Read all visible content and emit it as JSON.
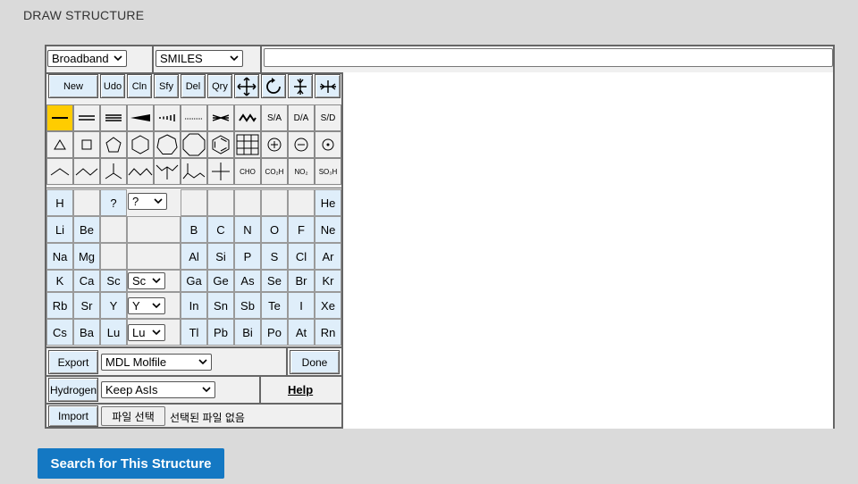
{
  "page": {
    "title": "DRAW STRUCTURE"
  },
  "toolbar": {
    "nmr_select": "Broadband",
    "format_select": "SMILES",
    "smiles_value": ""
  },
  "buttons": {
    "new": "New",
    "undo": "Udo",
    "clean": "Cln",
    "stereo": "Sfy",
    "delete": "Del",
    "query": "Qry",
    "export": "Export",
    "hydrogen": "Hydrogen",
    "import": "Import",
    "done": "Done"
  },
  "bond_tools": {
    "sa": "S/A",
    "da": "D/A",
    "sd": "S/D"
  },
  "group_tools": {
    "cho": "CHO",
    "co2h": "CO₂H",
    "no2": "NO₂",
    "so3h": "SO₃H"
  },
  "elements": {
    "row1": [
      "H",
      "?",
      "He"
    ],
    "row1_select": "?",
    "row2": [
      "Li",
      "Be",
      "B",
      "C",
      "N",
      "O",
      "F",
      "Ne"
    ],
    "row3": [
      "Na",
      "Mg",
      "Al",
      "Si",
      "P",
      "S",
      "Cl",
      "Ar"
    ],
    "row4": [
      "K",
      "Ca",
      "Sc",
      "Ga",
      "Ge",
      "As",
      "Se",
      "Br",
      "Kr"
    ],
    "row4_select": "Sc",
    "row5": [
      "Rb",
      "Sr",
      "Y",
      "In",
      "Sn",
      "Sb",
      "Te",
      "I",
      "Xe"
    ],
    "row5_select": "Y",
    "row6": [
      "Cs",
      "Ba",
      "Lu",
      "Tl",
      "Pb",
      "Bi",
      "Po",
      "At",
      "Rn"
    ],
    "row6_select": "Lu"
  },
  "export": {
    "format": "MDL Molfile"
  },
  "hydrogen": {
    "mode": "Keep AsIs"
  },
  "help": "Help",
  "import": {
    "file_button": "파일 선택",
    "file_status": "선택된 파일 없음"
  },
  "search_button": "Search for This Structure"
}
